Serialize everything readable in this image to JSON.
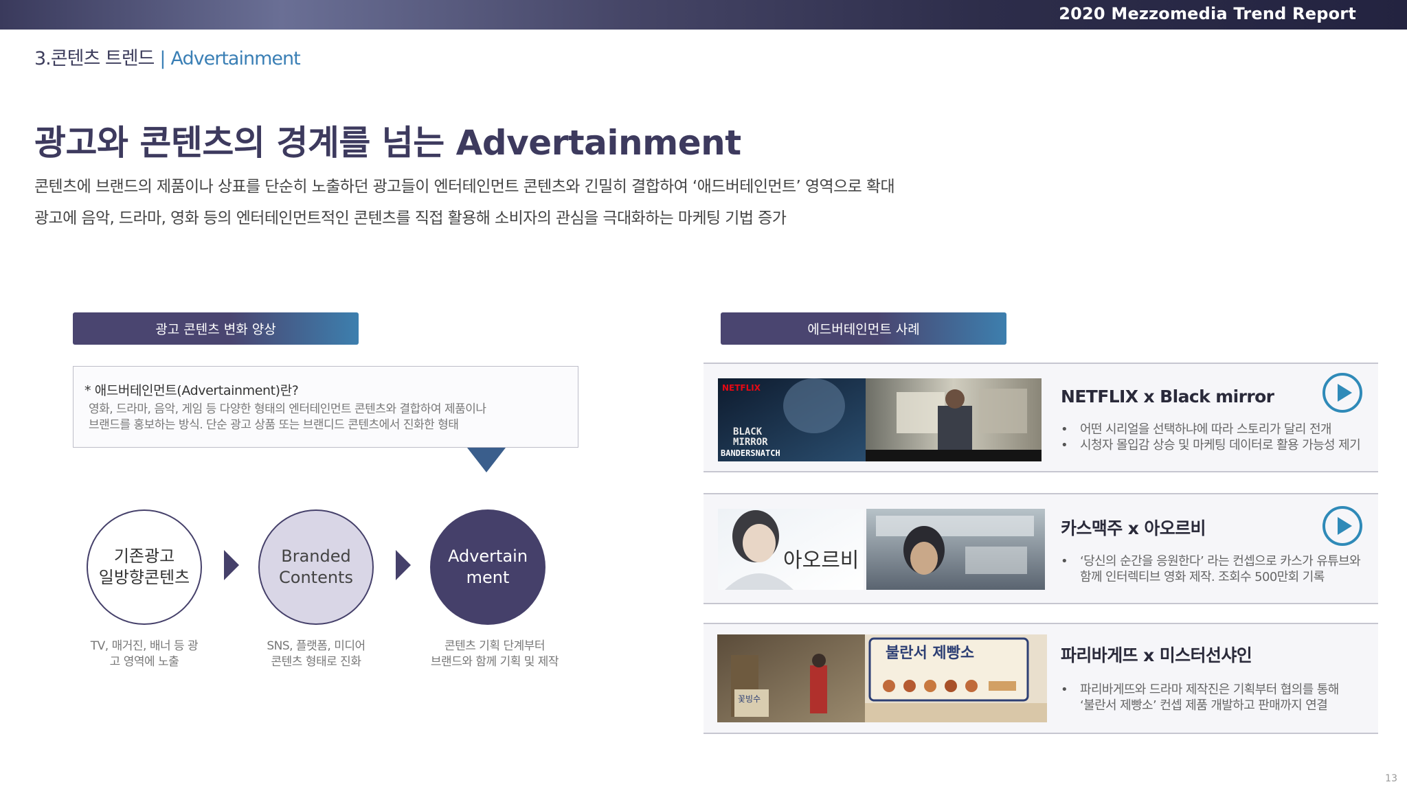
{
  "header": {
    "report_title": "2020 Mezzomedia Trend Report"
  },
  "section": {
    "label": "3.콘텐츠 트렌드",
    "separator": "|",
    "sublabel": "Advertainment"
  },
  "headline": "광고와 콘텐츠의 경계를 넘는 Advertainment",
  "description": [
    "콘텐츠에 브랜드의 제품이나 상표를 단순히 노출하던 광고들이 엔터테인먼트 콘텐츠와 긴밀히 결합하여 ‘애드버테인먼트’ 영역으로 확대",
    "광고에 음악, 드라마, 영화 등의 엔터테인먼트적인 콘텐츠를 직접 활용해 소비자의 관심을 극대화하는 마케팅 기법 증가"
  ],
  "left_panel": {
    "pill": "광고 콘텐츠 변화 양상",
    "definition": {
      "title": "* 애드버테인먼트(Advertainment)란?",
      "lines": [
        "영화, 드라마, 음악, 게임 등 다양한 형태의 엔터테인먼트 콘텐츠와 결합하여 제품이나",
        "브랜드를 홍보하는 방식. 단순 광고 상품 또는 브랜디드 콘텐츠에서 진화한 형태"
      ]
    },
    "stages": [
      {
        "lines": [
          "기존광고",
          "일방향콘텐츠"
        ],
        "caption": [
          "TV, 매거진, 배너 등 광",
          "고 영역에 노출"
        ]
      },
      {
        "lines": [
          "Branded",
          "Contents"
        ],
        "caption": [
          "SNS, 플랫폼, 미디어",
          "콘텐츠 형태로 진화"
        ]
      },
      {
        "lines": [
          "Advertain",
          "ment"
        ],
        "caption": [
          "콘텐츠 기획 단계부터",
          "브랜드와 함께 기획 및 제작"
        ]
      }
    ]
  },
  "right_panel": {
    "pill": "에드버테인먼트 사례",
    "cases": [
      {
        "title": "NETFLIX x Black mirror",
        "bullets": [
          "어떤 시리얼을 선택하냐에 따라 스토리가 달리 전개",
          "시청자 몰입감 상승 및 마케팅 데이터로 활용 가능성 제기"
        ],
        "thumb_text": [
          "NETFLIX",
          "BLACK",
          "MIRROR",
          "BANDERSNATCH"
        ],
        "has_play": true
      },
      {
        "title": "카스맥주 x 아오르비",
        "bullets": [
          "‘당신의 순간을 응원한다’ 라는 컨셉으로 카스가 유튜브와",
          "함께 인터렉티브 영화 제작. 조회수 500만회 기록"
        ],
        "thumb_text": [
          "아오르비"
        ],
        "has_play": true
      },
      {
        "title": "파리바게뜨 x 미스터선샤인",
        "bullets": [
          "파리바게뜨와 드라마 제작진은 기획부터 협의를 통해",
          "‘불란서 제빵소’ 컨셉 제품 개발하고 판매까지 연결"
        ],
        "thumb_text": [
          "불란서 제빵소",
          "꽃빙수"
        ],
        "has_play": false
      }
    ]
  },
  "page_number": "13",
  "colors": {
    "brand_purple": "#45406a",
    "accent_blue": "#3a7fb5",
    "play_icon": "#2f8ab8",
    "headline": "#3d3a5e"
  }
}
